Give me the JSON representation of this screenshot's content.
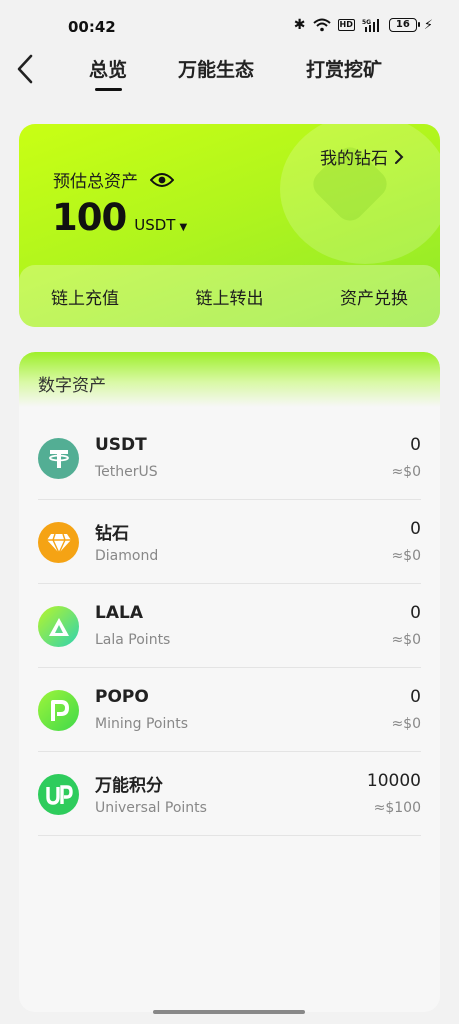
{
  "status_bar": {
    "time": "00:42",
    "bluetooth": "✱",
    "hd": "HD",
    "network": "5G",
    "battery": "16",
    "charging": "⚡"
  },
  "nav": {
    "tabs": [
      {
        "label": "总览",
        "active": true
      },
      {
        "label": "万能生态",
        "active": false
      },
      {
        "label": "打赏挖矿",
        "active": false
      }
    ]
  },
  "assets_card": {
    "my_diamond": "我的钻石",
    "estimate_label": "预估总资产",
    "total_value": "100",
    "total_unit": "USDT",
    "actions": [
      "链上充值",
      "链上转出",
      "资产兑换"
    ],
    "accent_color": "#b6f51e"
  },
  "digital_assets": {
    "title": "数字资产",
    "items": [
      {
        "name": "USDT",
        "sub": "TetherUS",
        "amount": "0",
        "value": "≈$0",
        "icon": "tether-icon",
        "color": "#53ae94"
      },
      {
        "name": "钻石",
        "sub": "Diamond",
        "amount": "0",
        "value": "≈$0",
        "icon": "diamond-icon",
        "color": "#f5a314"
      },
      {
        "name": "LALA",
        "sub": "Lala Points",
        "amount": "0",
        "value": "≈$0",
        "icon": "lala-icon",
        "color": "#3fd6a0"
      },
      {
        "name": "POPO",
        "sub": "Mining Points",
        "amount": "0",
        "value": "≈$0",
        "icon": "popo-icon",
        "color": "#5ee63a"
      },
      {
        "name": "万能积分",
        "sub": "Universal Points",
        "amount": "10000",
        "value": "≈$100",
        "icon": "up-icon",
        "color": "#2ecc5c"
      }
    ]
  }
}
